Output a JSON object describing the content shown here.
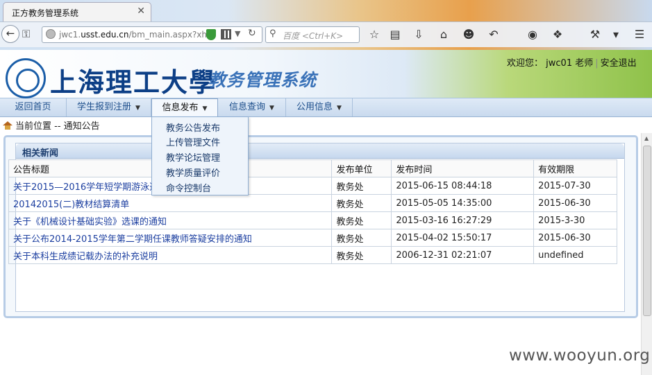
{
  "browser": {
    "tab_title": "正方教务管理系统",
    "url_prefix": "jwc1.",
    "url_host": "usst.edu.cn",
    "url_path": "/bm_main.aspx?xh=",
    "search_placeholder": "百度 <Ctrl+K>"
  },
  "header": {
    "school_name": "上海理工大學",
    "system_name": "教务管理系统",
    "welcome_label": "欢迎您：",
    "user_name": "jwc01",
    "role": "老师",
    "logout": "安全退出"
  },
  "menu": [
    {
      "label": "返回首页"
    },
    {
      "label": "学生报到注册"
    },
    {
      "label": "信息发布"
    },
    {
      "label": "信息查询"
    },
    {
      "label": "公用信息"
    }
  ],
  "dropdown": [
    {
      "label": "教务公告发布"
    },
    {
      "label": "上传管理文件"
    },
    {
      "label": "教学论坛管理"
    },
    {
      "label": "教学质量评价"
    },
    {
      "label": "命令控制台"
    }
  ],
  "location": {
    "label": "当前位置 -- ",
    "current": "通知公告"
  },
  "news": {
    "title": "相关新闻",
    "columns": [
      "公告标题",
      "发布单位",
      "发布时间",
      "有效期限"
    ],
    "rows": [
      {
        "title": "关于2015—2016学年短学期游泳选修课选课事宜的通知",
        "unit": "教务处",
        "time": "2015-06-15 08:44:18",
        "expire": "2015-07-30"
      },
      {
        "title": "20142015(二)教材结算清单",
        "unit": "教务处",
        "time": "2015-05-05 14:35:00",
        "expire": "2015-06-30"
      },
      {
        "title": "关于《机械设计基础实验》选课的通知",
        "unit": "教务处",
        "time": "2015-03-16 16:27:29",
        "expire": "2015-3-30"
      },
      {
        "title": "关于公布2014-2015学年第二学期任课教师答疑安排的通知",
        "unit": "教务处",
        "time": "2015-04-02 15:50:17",
        "expire": "2015-06-30"
      },
      {
        "title": "关于本科生成绩记载办法的补充说明",
        "unit": "教务处",
        "time": "2006-12-31 02:21:07",
        "expire": "undefined"
      }
    ]
  },
  "watermark": "www.wooyun.org"
}
